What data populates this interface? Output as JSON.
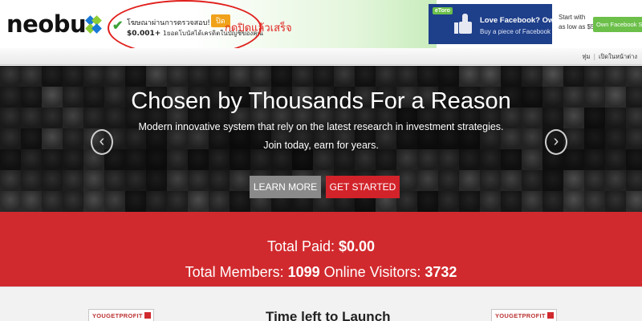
{
  "header": {
    "logo_text": "neobu",
    "logo_mark": "x",
    "notification": {
      "line1": "โฆษณาผ่านการตรวจสอบ!",
      "line2_amount": "$0.001+",
      "line2_text": " 1ยอดโบนัสได้เครดิตในบัญชีของคุณ",
      "close_label": "ปิด"
    },
    "annotation": "กดปิดแล้วเสร็จ",
    "annotation_color": "#e0201c",
    "ad": {
      "badge": "eToro",
      "title": "Love Facebook? Own it!",
      "subtitle": "Buy a piece of Facebook",
      "start_line1": "Start with",
      "start_line2": "as low as $50",
      "cta": "Own Facebook Stock"
    }
  },
  "subnav": {
    "item1": "ทุ่ม",
    "item2": "เปิดในหน้าต่าง"
  },
  "hero": {
    "headline": "Chosen by Thousands For a Reason",
    "tagline1": "Modern innovative system that rely on the latest research in investment strategies.",
    "tagline2": "Join today, earn for years.",
    "learn_more": "LEARN MORE",
    "get_started": "GET STARTED",
    "prev_icon": "chevron-left-icon",
    "next_icon": "chevron-right-icon",
    "prev_glyph": "‹",
    "next_glyph": "›"
  },
  "stats": {
    "total_paid_label": "Total Paid: ",
    "total_paid_value": "$0.00",
    "total_members_label": "Total Members: ",
    "total_members_value": "1099",
    "online_visitors_label": " Online Visitors: ",
    "online_visitors_value": "3732"
  },
  "bottom": {
    "left_card": "YOUGETPROFIT",
    "right_card": "YOUGETPROFIT",
    "launch_title": "Time left to Launch"
  },
  "colors": {
    "accent_red": "#d12a2e",
    "button_gray": "#8a8a8a",
    "button_red": "#d2232a",
    "ad_blue": "#1e3f8a",
    "ad_green": "#6cc04a"
  }
}
